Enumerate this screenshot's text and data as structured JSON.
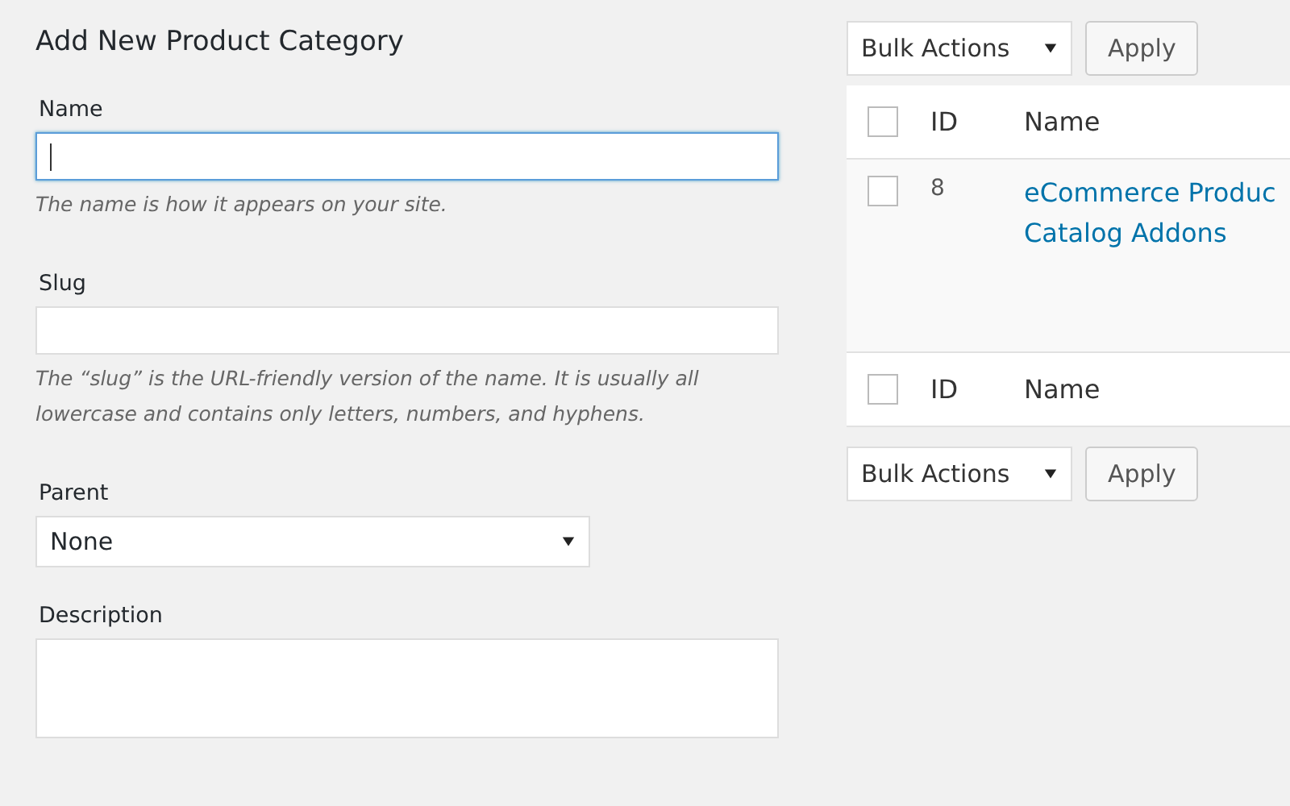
{
  "form": {
    "title": "Add New Product Category",
    "fields": [
      {
        "kind": "text",
        "label": "Name",
        "focused": true,
        "hint": "The name is how it appears on your site."
      },
      {
        "kind": "text",
        "label": "Slug",
        "focused": false,
        "hint": "The “slug” is the URL-friendly version of the name. It is usually all lowercase and contains only letters, numbers, and hyphens."
      },
      {
        "kind": "select",
        "label": "Parent",
        "value": "None"
      },
      {
        "kind": "textarea",
        "label": "Description"
      }
    ]
  },
  "top_actions": {
    "bulk": "Bulk Actions",
    "apply": "Apply"
  },
  "table": {
    "columns": [
      "ID",
      "Name"
    ],
    "header_checked": false,
    "rows": [
      {
        "id": "8",
        "name": "eCommerce Produc\nCatalog Addons",
        "checked": false
      }
    ],
    "footer_columns": [
      "ID",
      "Name"
    ],
    "footer_checked": false
  },
  "bottom_actions": {
    "bulk": "Bulk Actions",
    "apply": "Apply"
  }
}
